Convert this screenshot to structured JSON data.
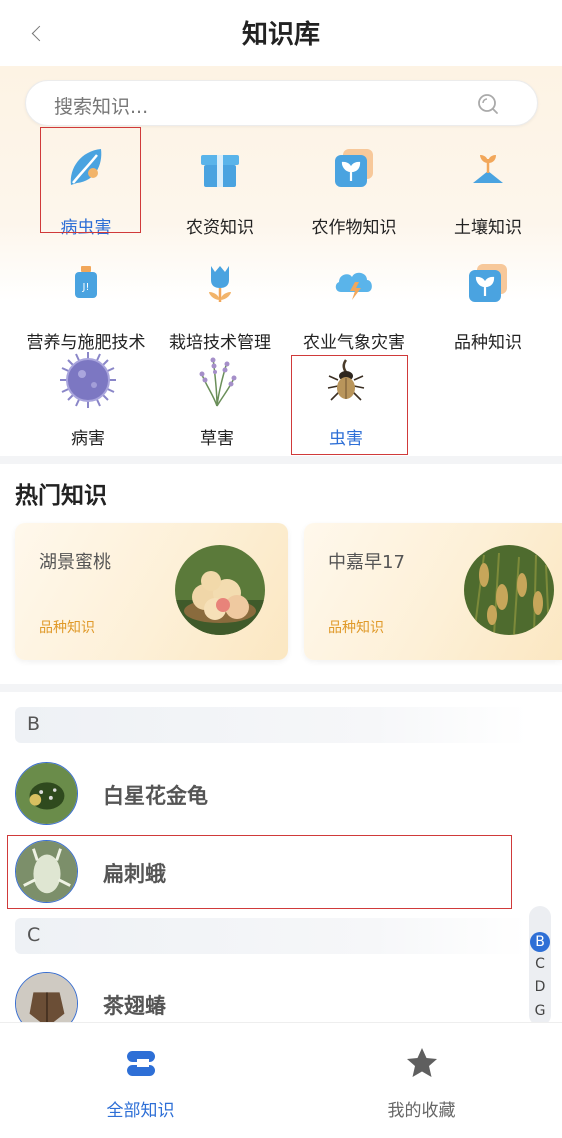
{
  "header": {
    "title": "知识库",
    "back_icon": "chevron-left-icon"
  },
  "search": {
    "placeholder": "搜索知识..."
  },
  "categories": [
    {
      "label": "病虫害",
      "icon": "pest-leaf-icon",
      "active": true
    },
    {
      "label": "农资知识",
      "icon": "gift-box-icon",
      "active": false
    },
    {
      "label": "农作物知识",
      "icon": "crop-sprout-icon",
      "active": false
    },
    {
      "label": "土壤知识",
      "icon": "soil-sprout-icon",
      "active": false
    },
    {
      "label": "营养与施肥技术",
      "icon": "fertilizer-bottle-icon",
      "active": false
    },
    {
      "label": "栽培技术管理",
      "icon": "tulip-icon",
      "active": false
    },
    {
      "label": "农业气象灾害",
      "icon": "weather-cloud-icon",
      "active": false
    },
    {
      "label": "品种知识",
      "icon": "variety-sprout-icon",
      "active": false
    },
    {
      "label": "病害",
      "icon": "virus-icon",
      "active": false
    },
    {
      "label": "草害",
      "icon": "weed-icon",
      "active": false
    },
    {
      "label": "虫害",
      "icon": "beetle-icon",
      "active": true
    }
  ],
  "hot": {
    "title": "热门知识",
    "cards": [
      {
        "name": "湖景蜜桃",
        "tag": "品种知识",
        "image": "peach-photo"
      },
      {
        "name": "中嘉早17",
        "tag": "品种知识",
        "image": "rice-photo"
      }
    ]
  },
  "index": {
    "groups": [
      {
        "letter": "B",
        "items": [
          {
            "name": "白星花金龟",
            "image": "white-spotted-beetle-photo"
          },
          {
            "name": "扁刺蛾",
            "image": "flat-moth-photo"
          }
        ]
      },
      {
        "letter": "C",
        "items": [
          {
            "name": "茶翅蝽",
            "image": "stink-bug-photo"
          }
        ]
      }
    ],
    "alphabet": [
      "B",
      "C",
      "D",
      "G"
    ],
    "selected_letter": "B"
  },
  "tabbar": {
    "tabs": [
      {
        "label": "全部知识",
        "icon": "stack-layers-icon",
        "active": true
      },
      {
        "label": "我的收藏",
        "icon": "star-icon",
        "active": false
      }
    ]
  },
  "colors": {
    "accent": "#2e6fd6",
    "tag": "#e09a2a",
    "highlight": "#d03a3a"
  }
}
